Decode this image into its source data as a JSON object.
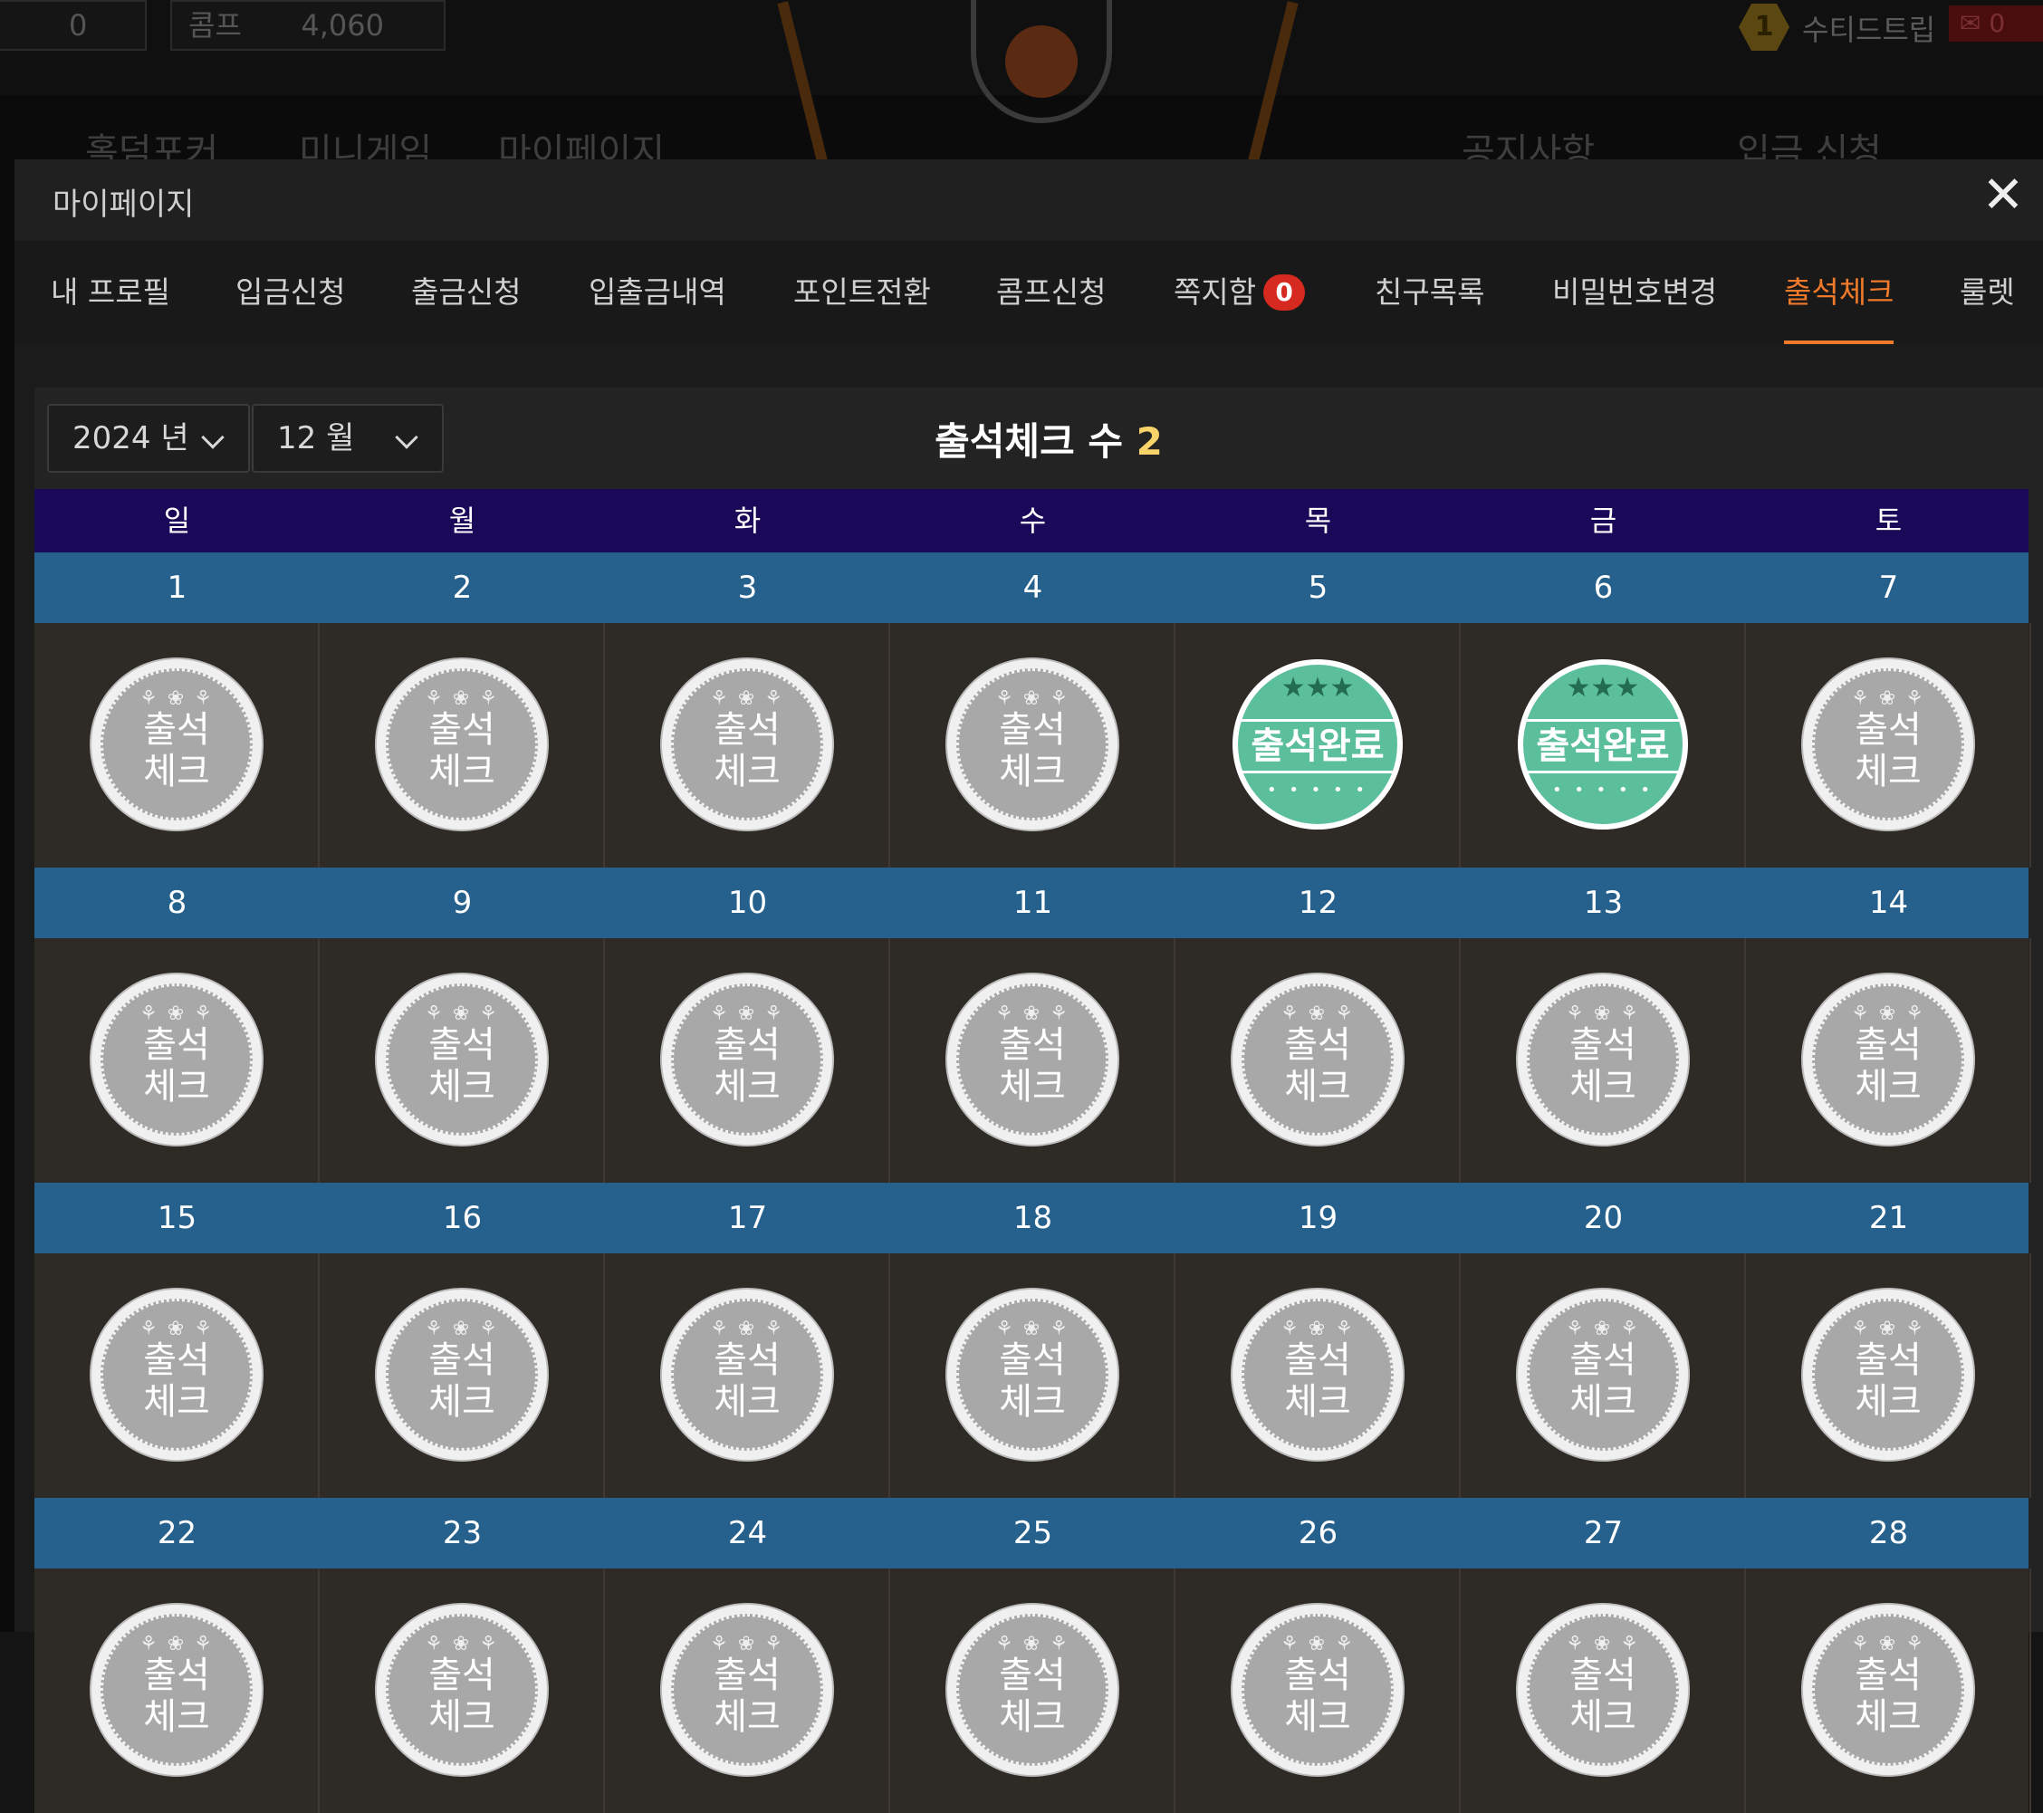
{
  "background": {
    "box1_value": "0",
    "box2_label": "콤프",
    "box2_value": "4,060",
    "nav": [
      "홀덤포커",
      "미니게임",
      "마이페이지",
      "공지사항",
      "입금 신청"
    ],
    "user_level": "1",
    "username": "수티드트립",
    "mail_count": "0"
  },
  "modal": {
    "title": "마이페이지",
    "close_label": "✕",
    "tabs": [
      {
        "label": "내 프로필"
      },
      {
        "label": "입금신청"
      },
      {
        "label": "출금신청"
      },
      {
        "label": "입출금내역"
      },
      {
        "label": "포인트전환"
      },
      {
        "label": "콤프신청"
      },
      {
        "label": "쪽지함",
        "badge": "0"
      },
      {
        "label": "친구목록"
      },
      {
        "label": "비밀번호변경"
      },
      {
        "label": "출석체크",
        "active": true
      },
      {
        "label": "룰렛"
      }
    ]
  },
  "attendance": {
    "year_select": "2024 년",
    "month_select": "12 월",
    "title_prefix": "출석체크 수",
    "count": "2",
    "weekdays": [
      "일",
      "월",
      "화",
      "수",
      "목",
      "금",
      "토"
    ],
    "stamp_gray_line1": "출석",
    "stamp_gray_line2": "체크",
    "stamp_gray_deco": "⚘ ❀ ⚘",
    "stamp_green_label": "출석완료",
    "stamp_green_stars": "★★★",
    "stamp_green_dots": "• • • • •",
    "weeks": [
      {
        "days": [
          "1",
          "2",
          "3",
          "4",
          "5",
          "6",
          "7"
        ],
        "status": [
          "check",
          "check",
          "check",
          "check",
          "done",
          "done",
          "check"
        ]
      },
      {
        "days": [
          "8",
          "9",
          "10",
          "11",
          "12",
          "13",
          "14"
        ],
        "status": [
          "check",
          "check",
          "check",
          "check",
          "check",
          "check",
          "check"
        ]
      },
      {
        "days": [
          "15",
          "16",
          "17",
          "18",
          "19",
          "20",
          "21"
        ],
        "status": [
          "check",
          "check",
          "check",
          "check",
          "check",
          "check",
          "check"
        ]
      },
      {
        "days": [
          "22",
          "23",
          "24",
          "25",
          "26",
          "27",
          "28"
        ],
        "status": [
          "check",
          "check",
          "check",
          "check",
          "check",
          "check",
          "check"
        ]
      }
    ]
  }
}
